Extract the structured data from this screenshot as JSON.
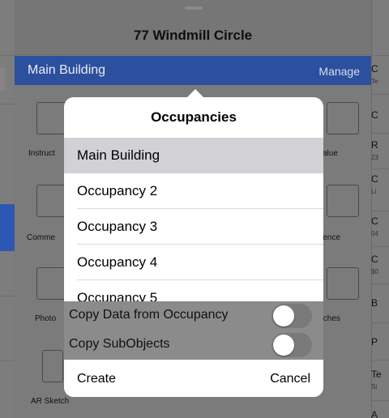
{
  "nav": {
    "title": "77 Windmill Circle"
  },
  "header": {
    "title": "Main Building",
    "manage_label": "Manage"
  },
  "tiles": [
    {
      "label": "Instruct",
      "icon": "hand-pointer-icon"
    },
    {
      "label": "Comme",
      "icon": "person-comment-icon"
    },
    {
      "label": "Photo",
      "icon": "photo-icon"
    },
    {
      "label": "AR Sketch",
      "icon": "ar-phone-icon"
    },
    {
      "label": "alue",
      "icon": "chart-icon"
    },
    {
      "label": "lence",
      "icon": "cases-icon"
    },
    {
      "label": "tches",
      "icon": "sketch-icon"
    }
  ],
  "right_col": [
    {
      "big": "C",
      "small": "Te"
    },
    {
      "big": "C",
      "small": ""
    },
    {
      "big": "R",
      "small": "23"
    },
    {
      "big": "C",
      "small": "Li"
    },
    {
      "big": "C",
      "small": "04"
    },
    {
      "big": "C",
      "small": "$0"
    },
    {
      "big": "B",
      "small": ""
    },
    {
      "big": "P",
      "small": ""
    },
    {
      "big": "Te",
      "small": "Si"
    },
    {
      "big": "A",
      "small": ""
    }
  ],
  "popover": {
    "title": "Occupancies",
    "items": [
      "Main Building",
      "Occupancy 2",
      "Occupancy 3",
      "Occupancy 4",
      "Occupancy 5"
    ],
    "selected_index": 0,
    "options": [
      {
        "label": "Copy Data from Occupancy",
        "on": false
      },
      {
        "label": "Copy SubObjects",
        "on": false
      }
    ],
    "create_label": "Create",
    "cancel_label": "Cancel"
  },
  "colors": {
    "selected_row": "#d1d1d6",
    "header_blue": "#2c4f9e"
  }
}
